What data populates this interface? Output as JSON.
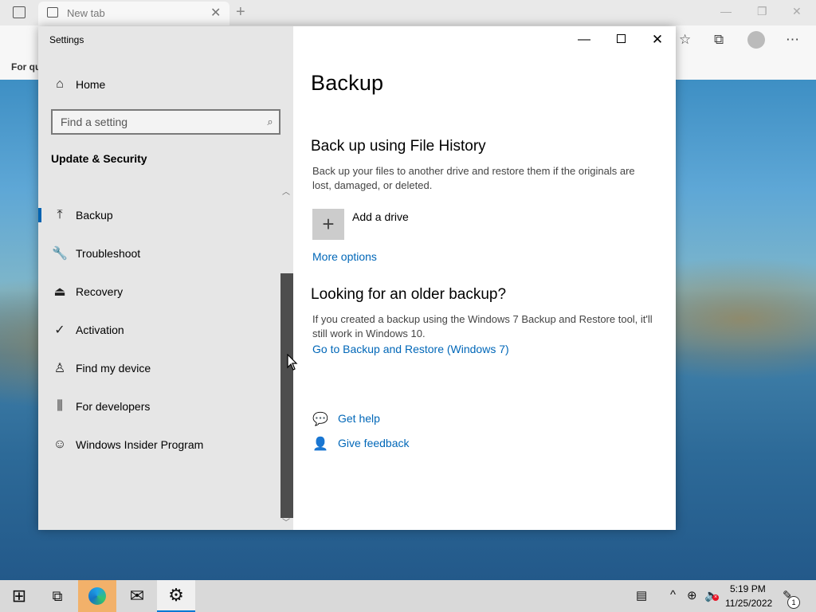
{
  "browser": {
    "tab_title": "New tab",
    "tab_close": "✕",
    "new_tab": "+",
    "favbar_text": "For qu",
    "win_minimize": "—",
    "win_restore": "❐",
    "win_close": "✕",
    "toolbar_icons": [
      "☆",
      "⧉",
      "⋯"
    ]
  },
  "settings": {
    "window_title": "Settings",
    "controls": {
      "minimize": "—",
      "close": "✕"
    },
    "home_label": "Home",
    "search": {
      "placeholder": "Find a setting",
      "icon": "⌕"
    },
    "section_title": "Update & Security",
    "nav_items": [
      {
        "label": "Backup",
        "icon": "⤒"
      },
      {
        "label": "Troubleshoot",
        "icon": "🔧"
      },
      {
        "label": "Recovery",
        "icon": "⏏"
      },
      {
        "label": "Activation",
        "icon": "✓"
      },
      {
        "label": "Find my device",
        "icon": "♙"
      },
      {
        "label": "For developers",
        "icon": "⫼"
      },
      {
        "label": "Windows Insider Program",
        "icon": "☺"
      }
    ],
    "scroll_up": "︿",
    "scroll_down": "﹀",
    "page_title": "Backup",
    "file_history": {
      "heading": "Back up using File History",
      "description": "Back up your files to another drive and restore them if the originals are lost, damaged, or deleted.",
      "add_drive_icon": "+",
      "add_drive_label": "Add a drive",
      "more_options": "More options"
    },
    "older_backup": {
      "heading": "Looking for an older backup?",
      "description": "If you created a backup using the Windows 7 Backup and Restore tool, it'll still work in Windows 10.",
      "link": "Go to Backup and Restore (Windows 7)"
    },
    "help": {
      "get_help": "Get help",
      "give_feedback": "Give feedback"
    }
  },
  "taskbar": {
    "time": "5:19 PM",
    "date": "11/25/2022",
    "notification_count": "1",
    "start_icon": "⊞",
    "taskview_icon": "⧉",
    "mail_icon": "✉",
    "settings_icon": "⚙",
    "tray_icons": [
      "▤",
      "^",
      "⊕",
      "🔈",
      "✎"
    ],
    "volume_mute_mark": "×"
  },
  "colors": {
    "accent": "#0078d4",
    "link": "#0067b8",
    "sidebar_bg": "#e6e6e6",
    "taskbar_bg": "#d9d9d9"
  }
}
